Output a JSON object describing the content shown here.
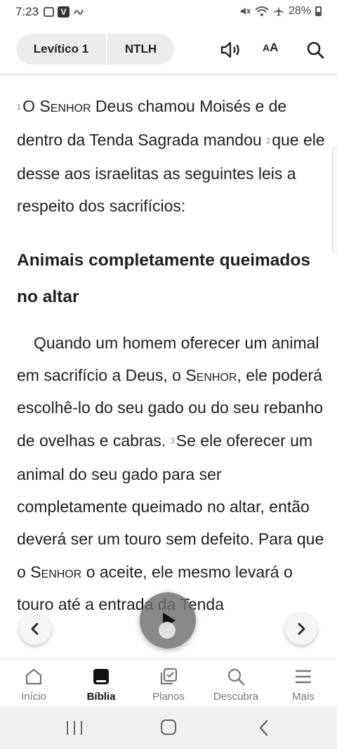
{
  "status_bar": {
    "time": "7:23",
    "battery": "28%"
  },
  "header": {
    "book": "Levítico 1",
    "version": "NTLH",
    "text_size_big": "A",
    "text_size_small": "A"
  },
  "passage": {
    "p1": {
      "v1": "1",
      "a": "O ",
      "lord1": "Senhor",
      "b": " Deus chamou Moisés e de dentro da Tenda Sagrada mandou ",
      "v2": "2",
      "c": "que ele desse aos israelitas as seguintes leis a respeito dos sacrifícios:"
    },
    "heading": "Animais completamente queimados no altar",
    "p2": {
      "a": "Quando um homem oferecer um animal em sacrifício a Deus, o ",
      "lord2": "Senhor",
      "b": ", ele poderá escolhê-lo do seu gado ou do seu rebanho de ovelhas e cabras. ",
      "v3": "3",
      "c": "Se ele oferecer um animal do seu gado para ser completamente queimado no altar, então deverá ser um touro sem defeito. Para que o ",
      "lord3": "Senhor",
      "d": " o aceite, ele mesmo levará o touro até a entrada da Tenda"
    }
  },
  "nav": {
    "items": [
      {
        "label": "Início"
      },
      {
        "label": "Bíblia"
      },
      {
        "label": "Planos"
      },
      {
        "label": "Descubra"
      },
      {
        "label": "Mais"
      }
    ]
  }
}
